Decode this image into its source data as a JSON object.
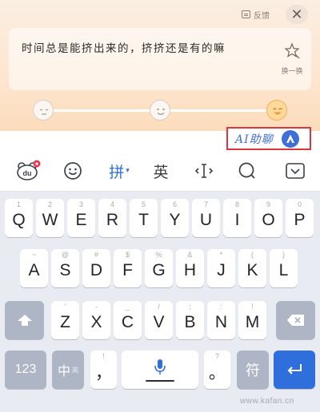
{
  "header": {
    "feedback_label": "反馈",
    "close_label": "✕"
  },
  "suggestion": {
    "text": "时间总是能挤出来的，挤挤还是有的嘛",
    "refresh_label": "换一换"
  },
  "tone_slider": {
    "levels": [
      "calm",
      "smile",
      "laugh"
    ],
    "selected_index": 2
  },
  "ai_assistant": {
    "label": "AI助聊"
  },
  "toolbar": {
    "items": [
      {
        "name": "du-logo",
        "icon": "du-bear-icon",
        "badge": true
      },
      {
        "name": "emoji",
        "icon": "emoji-icon"
      },
      {
        "name": "pinyin",
        "label": "拼",
        "caret": "▾"
      },
      {
        "name": "english",
        "label": "英"
      },
      {
        "name": "cursor",
        "icon": "cursor-move-icon"
      },
      {
        "name": "search",
        "icon": "search-icon"
      },
      {
        "name": "hide-keyboard",
        "icon": "keyboard-hide-icon"
      }
    ]
  },
  "keyboard": {
    "row1": [
      {
        "main": "Q",
        "hint": "1"
      },
      {
        "main": "W",
        "hint": "2"
      },
      {
        "main": "E",
        "hint": "3"
      },
      {
        "main": "R",
        "hint": "4"
      },
      {
        "main": "T",
        "hint": "5"
      },
      {
        "main": "Y",
        "hint": "6"
      },
      {
        "main": "U",
        "hint": "7"
      },
      {
        "main": "I",
        "hint": "8"
      },
      {
        "main": "O",
        "hint": "9"
      },
      {
        "main": "P",
        "hint": "0"
      }
    ],
    "row2": [
      {
        "main": "A",
        "hint": "~"
      },
      {
        "main": "S",
        "hint": "@"
      },
      {
        "main": "D",
        "hint": "#"
      },
      {
        "main": "F",
        "hint": "$"
      },
      {
        "main": "G",
        "hint": "%"
      },
      {
        "main": "H",
        "hint": "&"
      },
      {
        "main": "J",
        "hint": "*"
      },
      {
        "main": "K",
        "hint": "("
      },
      {
        "main": "L",
        "hint": ")"
      }
    ],
    "row3": [
      {
        "main": "Z",
        "hint": "'"
      },
      {
        "main": "X",
        "hint": "-"
      },
      {
        "main": "C",
        "hint": "_"
      },
      {
        "main": "V",
        "hint": "/"
      },
      {
        "main": "B",
        "hint": ";"
      },
      {
        "main": "N",
        "hint": ":"
      },
      {
        "main": "M",
        "hint": "!"
      }
    ],
    "row4": {
      "num_label": "123",
      "zh_label": "中",
      "zh_sub": "英",
      "comma_main": "，",
      "comma_hint": "!",
      "period_main": "。",
      "period_hint": "?",
      "enter_label": "符"
    }
  },
  "colors": {
    "accent": "#2f6fdc",
    "highlight_border": "#d9363e"
  },
  "watermark": "www.kafan.cn"
}
